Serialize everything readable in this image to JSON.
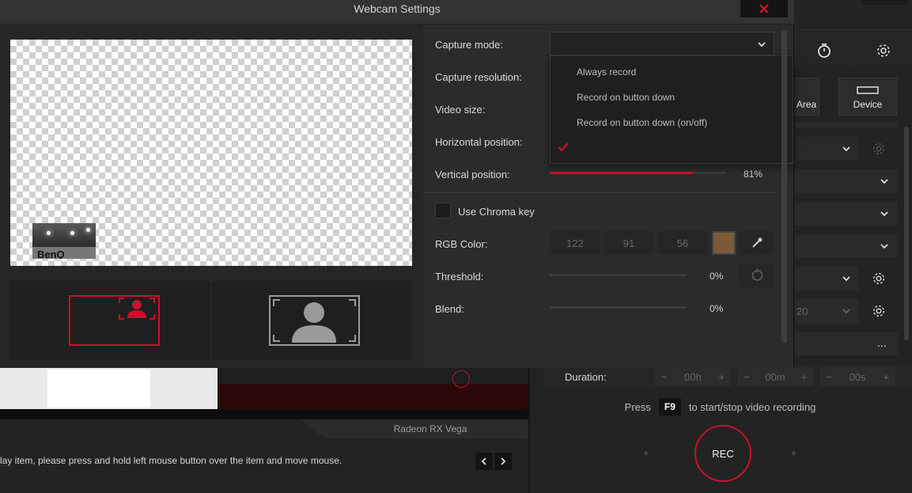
{
  "dialog": {
    "title": "Webcam Settings",
    "close_label": "✕"
  },
  "settings": {
    "capture_mode_label": "Capture mode:",
    "capture_resolution_label": "Capture resolution:",
    "video_size_label": "Video size:",
    "horizontal_position_label": "Horizontal position:",
    "vertical_position_label": "Vertical position:",
    "vertical_position_value": "81%",
    "vertical_position_level": 0.81,
    "capture_mode_options": [
      "Always record",
      "Record on button down",
      "Record on button down (on/off)",
      ""
    ],
    "selected_option_index": 3,
    "use_chroma_key_label": "Use Chroma key",
    "rgb_color_label": "RGB Color:",
    "rgb": {
      "r": "122",
      "g": "91",
      "b": "56"
    },
    "swatch_color": "#7a5b38",
    "threshold_label": "Threshold:",
    "threshold_value": "0%",
    "blend_label": "Blend:",
    "blend_value": "0%"
  },
  "preview": {
    "cam_text": "BenQ"
  },
  "background_app": {
    "area_label": "Area",
    "device_label": "Device",
    "more_label": "...",
    "duration_label": "Duration:",
    "duration_hours": "00h",
    "duration_minutes": "00m",
    "duration_seconds": "00s",
    "minus": "−",
    "plus": "+",
    "resolution_partial": "20",
    "press_label": "Press",
    "hotkey": "F9",
    "hotkey_hint": "to start/stop video recording",
    "rec_label": "REC",
    "gpu_label": "Radeon RX Vega",
    "hint_text": "lay item, please press and hold left mouse button over the item and move mouse."
  },
  "colors": {
    "accent": "#c8102e",
    "dialog_bg": "#2b2b2b",
    "titlebar_bg": "#333333"
  }
}
